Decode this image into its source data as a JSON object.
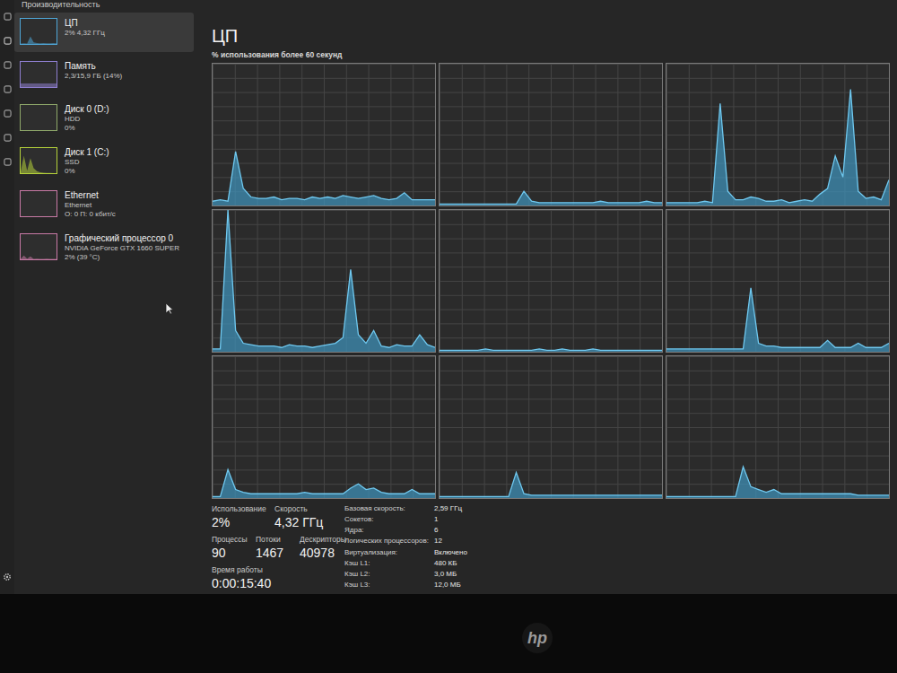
{
  "window": {
    "title": "Производительность"
  },
  "sidebar": {
    "items": [
      {
        "name": "ЦП",
        "lines": [
          "2% 4,32 ГГц"
        ],
        "selected": true,
        "color": "#4fa7d8",
        "spark": [
          2,
          3,
          2,
          30,
          6,
          4,
          3,
          4,
          3,
          3,
          4,
          3
        ]
      },
      {
        "name": "Память",
        "lines": [
          "2,3/15,9 ГБ (14%)"
        ],
        "selected": false,
        "color": "#8f7fd0",
        "spark": [
          14,
          14,
          14,
          14,
          14,
          14,
          14,
          14,
          14,
          14,
          14,
          14
        ]
      },
      {
        "name": "Диск 0 (D:)",
        "lines": [
          "HDD",
          "0%"
        ],
        "selected": false,
        "color": "#8fa86a",
        "spark": [
          0,
          0,
          0,
          0,
          0,
          0,
          0,
          0,
          0,
          0,
          0,
          0
        ]
      },
      {
        "name": "Диск 1 (C:)",
        "lines": [
          "SSD",
          "0%"
        ],
        "selected": false,
        "color": "#b6d33a",
        "spark": [
          5,
          70,
          10,
          60,
          20,
          8,
          4,
          2,
          1,
          1,
          0,
          0
        ]
      },
      {
        "name": "Ethernet",
        "lines": [
          "Ethernet",
          "О: 0 П: 0 кбит/с"
        ],
        "selected": false,
        "color": "#c97aa6",
        "spark": [
          0,
          0,
          0,
          0,
          0,
          0,
          0,
          0,
          0,
          0,
          0,
          0
        ]
      },
      {
        "name": "Графический процессор 0",
        "lines": [
          "NVIDIA GeForce GTX 1660 SUPER",
          "2% (39 °C)"
        ],
        "selected": false,
        "color": "#c97aa6",
        "spark": [
          2,
          15,
          3,
          12,
          2,
          3,
          2,
          2,
          3,
          2,
          2,
          2
        ]
      }
    ]
  },
  "main": {
    "title": "ЦП",
    "subtitle": "% использования более 60 секунд"
  },
  "charts": [
    {
      "values": [
        3,
        4,
        3,
        38,
        12,
        6,
        5,
        5,
        6,
        4,
        5,
        5,
        4,
        6,
        5,
        6,
        5,
        7,
        6,
        5,
        6,
        7,
        5,
        4,
        5,
        9,
        4,
        4,
        4,
        4
      ]
    },
    {
      "values": [
        1,
        1,
        1,
        1,
        1,
        1,
        1,
        1,
        1,
        1,
        1,
        10,
        3,
        2,
        2,
        2,
        2,
        2,
        2,
        2,
        2,
        3,
        2,
        2,
        2,
        2,
        2,
        3,
        2,
        2
      ]
    },
    {
      "values": [
        2,
        2,
        2,
        2,
        2,
        3,
        2,
        72,
        10,
        4,
        4,
        6,
        5,
        3,
        3,
        4,
        2,
        3,
        4,
        3,
        8,
        12,
        35,
        20,
        82,
        10,
        5,
        6,
        4,
        18
      ]
    },
    {
      "values": [
        2,
        2,
        100,
        15,
        6,
        5,
        4,
        4,
        4,
        3,
        5,
        4,
        4,
        3,
        4,
        5,
        6,
        10,
        58,
        12,
        6,
        15,
        4,
        3,
        5,
        4,
        4,
        12,
        5,
        3
      ]
    },
    {
      "values": [
        1,
        1,
        1,
        1,
        1,
        1,
        2,
        1,
        1,
        1,
        1,
        1,
        1,
        2,
        1,
        1,
        2,
        1,
        1,
        1,
        2,
        1,
        1,
        1,
        1,
        1,
        1,
        1,
        1,
        1
      ]
    },
    {
      "values": [
        2,
        2,
        2,
        2,
        2,
        2,
        2,
        2,
        2,
        2,
        2,
        45,
        6,
        4,
        4,
        3,
        3,
        3,
        3,
        3,
        3,
        8,
        3,
        3,
        3,
        6,
        3,
        3,
        3,
        6
      ]
    },
    {
      "values": [
        1,
        1,
        20,
        6,
        4,
        3,
        3,
        3,
        3,
        3,
        3,
        3,
        4,
        3,
        3,
        3,
        3,
        3,
        7,
        10,
        6,
        7,
        4,
        3,
        3,
        3,
        6,
        3,
        3,
        3
      ]
    },
    {
      "values": [
        1,
        1,
        1,
        1,
        1,
        1,
        1,
        1,
        1,
        1,
        18,
        3,
        2,
        2,
        2,
        2,
        2,
        2,
        2,
        2,
        2,
        2,
        2,
        2,
        2,
        2,
        2,
        2,
        2,
        2
      ]
    },
    {
      "values": [
        1,
        1,
        1,
        1,
        1,
        1,
        1,
        1,
        1,
        1,
        22,
        8,
        6,
        4,
        6,
        3,
        3,
        3,
        3,
        3,
        3,
        3,
        3,
        3,
        3,
        2,
        2,
        2,
        2,
        2
      ]
    }
  ],
  "stats": {
    "row1": [
      {
        "label": "Использование",
        "value": "2%"
      },
      {
        "label": "Скорость",
        "value": "4,32 ГГц"
      }
    ],
    "row2": [
      {
        "label": "Процессы",
        "value": "90"
      },
      {
        "label": "Потоки",
        "value": "1467"
      },
      {
        "label": "Дескрипторы",
        "value": "40978"
      }
    ],
    "uptime": {
      "label": "Время работы",
      "value": "0:00:15:40"
    },
    "details": [
      {
        "key": "Базовая скорость:",
        "value": "2,59 ГГц"
      },
      {
        "key": "Сокетов:",
        "value": "1"
      },
      {
        "key": "Ядра:",
        "value": "6"
      },
      {
        "key": "Логических процессоров:",
        "value": "12"
      },
      {
        "key": "Виртуализация:",
        "value": "Включено"
      },
      {
        "key": "Кэш L1:",
        "value": "480 КБ"
      },
      {
        "key": "Кэш L2:",
        "value": "3,0 МБ"
      },
      {
        "key": "Кэш L3:",
        "value": "12,0 МБ"
      }
    ]
  },
  "monitor": {
    "logo": "hp"
  }
}
